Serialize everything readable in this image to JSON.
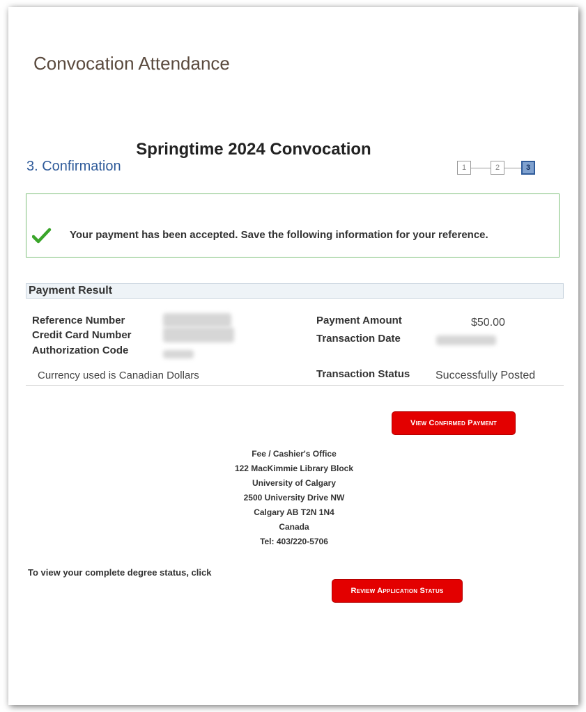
{
  "page": {
    "title": "Convocation Attendance",
    "term": "Springtime 2024 Convocation",
    "step_title": "3. Confirmation"
  },
  "train": {
    "steps": [
      {
        "label": "1",
        "state": "done"
      },
      {
        "label": "2",
        "state": "done"
      },
      {
        "label": "3",
        "state": "current"
      }
    ]
  },
  "message": {
    "icon": "checkmark-icon",
    "text": "Your payment has been accepted. Save the following information for your reference."
  },
  "payment_result": {
    "header": "Payment Result",
    "left_labels": [
      "Reference Number",
      "Credit Card Number",
      "Authorization Code"
    ],
    "currency_note": "Currency used is Canadian Dollars",
    "payment_amount_label": "Payment Amount",
    "payment_amount": "$50.00",
    "transaction_date_label": "Transaction Date",
    "transaction_status_label": "Transaction Status",
    "transaction_status": "Successfully Posted"
  },
  "buttons": {
    "view_confirmed_payment": "View Confirmed Payment",
    "review_application_status": "Review Application Status"
  },
  "address": {
    "lines": [
      "Fee / Cashier's Office",
      "122 MacKimmie Library Block",
      "University of Calgary",
      "2500 University Drive NW",
      "Calgary AB T2N 1N4",
      "Canada",
      "Tel: 403/220-5706"
    ]
  },
  "degree_status": {
    "text": "To view your complete degree status, click"
  },
  "colors": {
    "button": "#e30000",
    "step_title": "#2f5b9a",
    "message_border": "#7ec07a",
    "check": "#3aa52a"
  }
}
